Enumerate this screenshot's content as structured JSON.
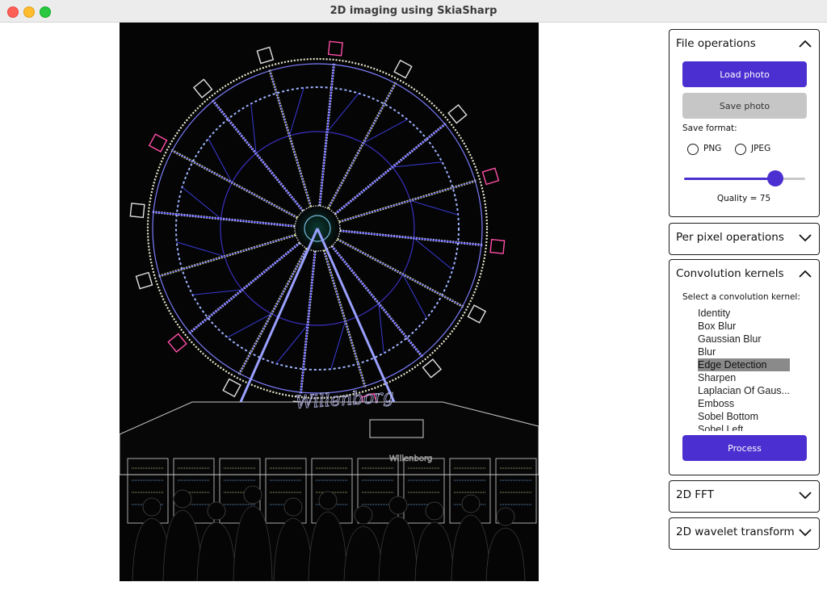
{
  "window": {
    "title": "2D imaging using SkiaSharp"
  },
  "colors": {
    "accent": "#4b2fd0",
    "disabled": "#c6c6c6",
    "image_bg": "#050505"
  },
  "file_operations": {
    "title": "File operations",
    "expanded": true,
    "load_label": "Load photo",
    "save_label": "Save photo",
    "save_format_label": "Save format:",
    "formats": [
      "PNG",
      "JPEG"
    ],
    "selected_format": "",
    "quality_text": "Quality = 75",
    "quality_value": 75,
    "quality_max": 100
  },
  "per_pixel": {
    "title": "Per pixel operations",
    "expanded": false
  },
  "convolution": {
    "title": "Convolution kernels",
    "expanded": true,
    "select_label": "Select a convolution kernel:",
    "kernels": [
      "Identity",
      "Box Blur",
      "Gaussian Blur",
      "Blur",
      "Edge Detection",
      "Sharpen",
      "Laplacian Of Gaus...",
      "Emboss",
      "Sobel Bottom",
      "Sobel Left"
    ],
    "selected_kernel": "Edge Detection",
    "process_label": "Process"
  },
  "fft": {
    "title": "2D FFT",
    "expanded": false
  },
  "wavelet": {
    "title": "2D wavelet transform",
    "expanded": false
  },
  "image": {
    "sign_text": "Willenborg",
    "kiosk_text": "Willenborg"
  }
}
